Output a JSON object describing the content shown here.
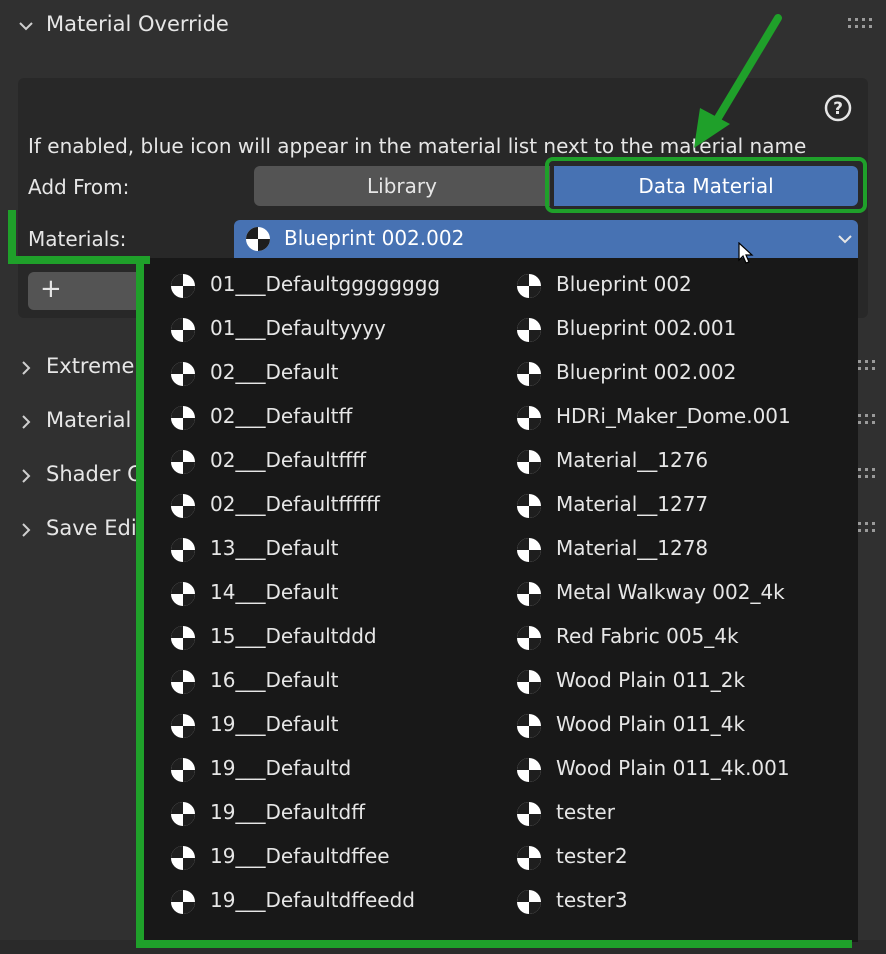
{
  "panels": {
    "material_override": "Material Override",
    "extreme": "Extreme F",
    "material_e": "Material E",
    "shader_ov": "Shader Ov",
    "save_edit": "Save Editi"
  },
  "info_text": "If enabled, blue icon will appear in the material list next to the material name",
  "add_from": {
    "label": "Add From:",
    "options": [
      "Library",
      "Data Material"
    ],
    "selected": "Data Material"
  },
  "materials": {
    "label": "Materials:",
    "selected": "Blueprint 002.002"
  },
  "plus_label": "+",
  "dropdown": {
    "left": [
      "01___Defaultgggggggg",
      "01___Defaultyyyy",
      "02___Default",
      "02___Defaultff",
      "02___Defaultffff",
      "02___Defaultffffff",
      "13___Default",
      "14___Default",
      "15___Defaultddd",
      "16___Default",
      "19___Default",
      "19___Defaultd",
      "19___Defaultdff",
      "19___Defaultdffee",
      "19___Defaultdffeedd"
    ],
    "right": [
      "Blueprint 002",
      "Blueprint 002.001",
      "Blueprint 002.002",
      "HDRi_Maker_Dome.001",
      "Material__1276",
      "Material__1277",
      "Material__1278",
      "Metal Walkway 002_4k",
      "Red Fabric 005_4k",
      "Wood Plain 011_2k",
      "Wood Plain 011_4k",
      "Wood Plain 011_4k.001",
      "tester",
      "tester2",
      "tester3"
    ]
  },
  "colors": {
    "accent_blue": "#4772b3",
    "highlight_green": "#1fa02a",
    "panel_bg": "#303030",
    "dropdown_bg": "#181818"
  }
}
